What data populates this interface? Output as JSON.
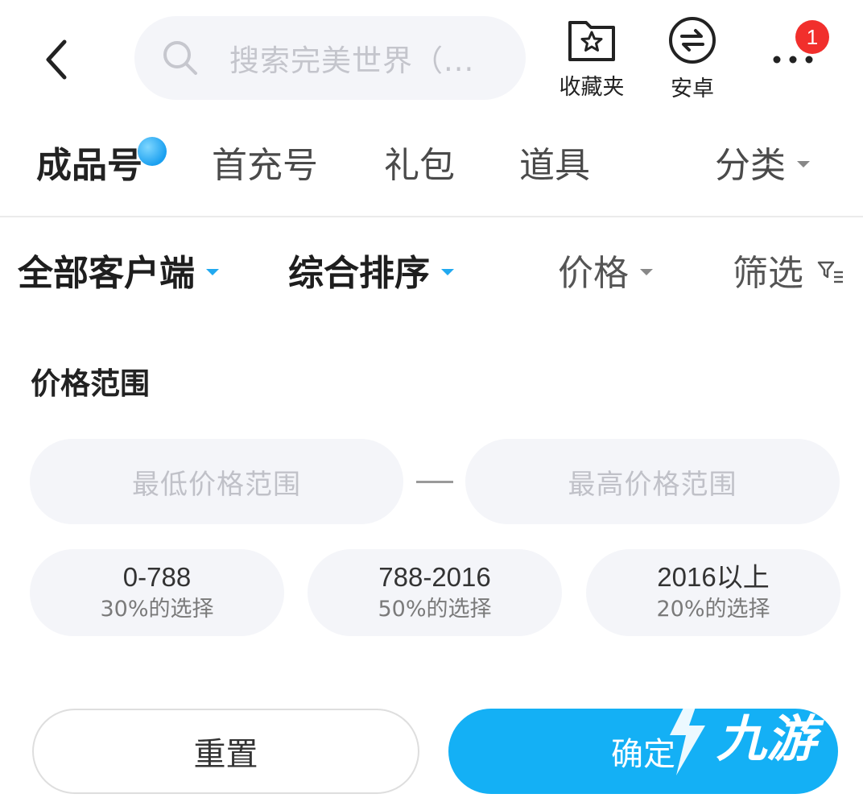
{
  "header": {
    "search_placeholder": "搜索完美世界（...",
    "favorites_label": "收藏夹",
    "android_label": "安卓",
    "notification_count": "1",
    "icons": {
      "back": "chevron-left-icon",
      "search": "search-icon",
      "favorites": "star-folder-icon",
      "android": "swap-arrows-icon",
      "more": "more-dots-icon"
    }
  },
  "tabs": {
    "items": [
      "成品号",
      "首充号",
      "礼包",
      "道具"
    ],
    "category_label": "分类"
  },
  "filters": {
    "client": "全部客户端",
    "sort": "综合排序",
    "price": "价格",
    "screen": "筛选"
  },
  "price_range": {
    "title": "价格范围",
    "min_placeholder": "最低价格范围",
    "max_placeholder": "最高价格范围",
    "options": [
      {
        "range": "0-788",
        "share": "30%的选择"
      },
      {
        "range": "788-2016",
        "share": "50%的选择"
      },
      {
        "range": "2016以上",
        "share": "20%的选择"
      }
    ]
  },
  "actions": {
    "reset": "重置",
    "confirm": "确定"
  },
  "watermark": "九游",
  "colors": {
    "accent": "#14b0f5",
    "badge": "#f12f2c",
    "input_bg": "#f4f5f9"
  }
}
